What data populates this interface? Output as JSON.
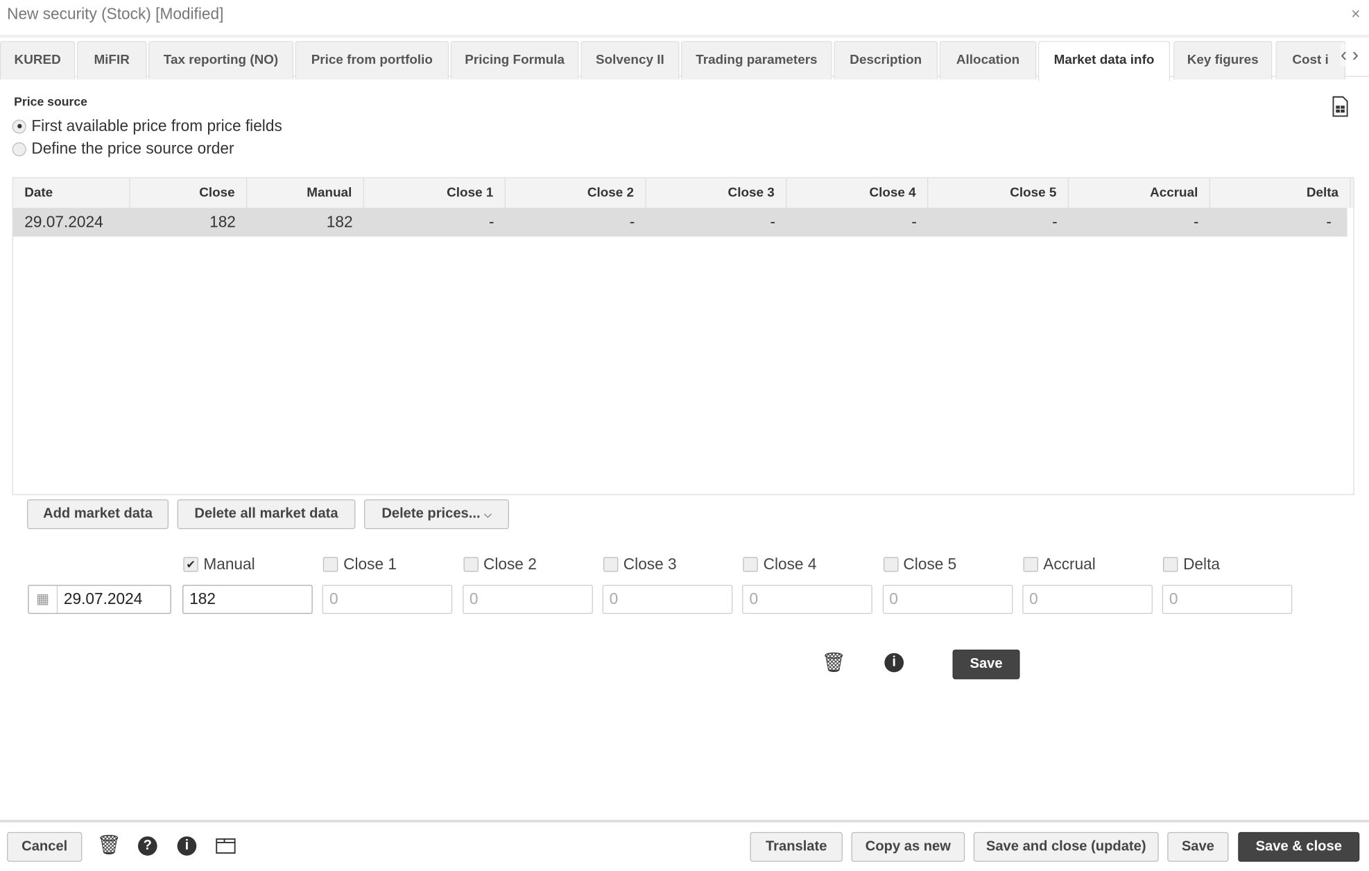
{
  "window": {
    "title": "New security (Stock) [Modified]",
    "close": "×"
  },
  "tabs": [
    "KURED",
    "MiFIR",
    "Tax reporting (NO)",
    "Price from portfolio",
    "Pricing Formula",
    "Solvency II",
    "Trading parameters",
    "Description",
    "Allocation",
    "Market data info",
    "Key figures",
    "Cost i"
  ],
  "active_tab": "Market data info",
  "price_source": {
    "label": "Price source",
    "options": [
      {
        "label": "First available price from price fields",
        "selected": true
      },
      {
        "label": "Define the price source order",
        "selected": false
      }
    ]
  },
  "grid": {
    "columns": [
      "Date",
      "Close",
      "Manual",
      "Close 1",
      "Close 2",
      "Close 3",
      "Close 4",
      "Close 5",
      "Accrual",
      "Delta"
    ],
    "rows": [
      [
        "29.07.2024",
        "182",
        "182",
        "-",
        "-",
        "-",
        "-",
        "-",
        "-",
        "-"
      ]
    ]
  },
  "actions": {
    "add": "Add market data",
    "delete_all": "Delete all market data",
    "delete_prices": "Delete prices..."
  },
  "editor": {
    "checkboxes": [
      {
        "label": "Manual",
        "checked": true
      },
      {
        "label": "Close 1",
        "checked": false
      },
      {
        "label": "Close 2",
        "checked": false
      },
      {
        "label": "Close 3",
        "checked": false
      },
      {
        "label": "Close 4",
        "checked": false
      },
      {
        "label": "Close 5",
        "checked": false
      },
      {
        "label": "Accrual",
        "checked": false
      },
      {
        "label": "Delta",
        "checked": false
      }
    ],
    "date": "29.07.2024",
    "values": [
      "182",
      "0",
      "0",
      "0",
      "0",
      "0",
      "0",
      "0"
    ],
    "save": "Save"
  },
  "footer": {
    "cancel": "Cancel",
    "translate": "Translate",
    "copy": "Copy as new",
    "save_close_update": "Save and close (update)",
    "save": "Save",
    "save_close": "Save & close"
  }
}
